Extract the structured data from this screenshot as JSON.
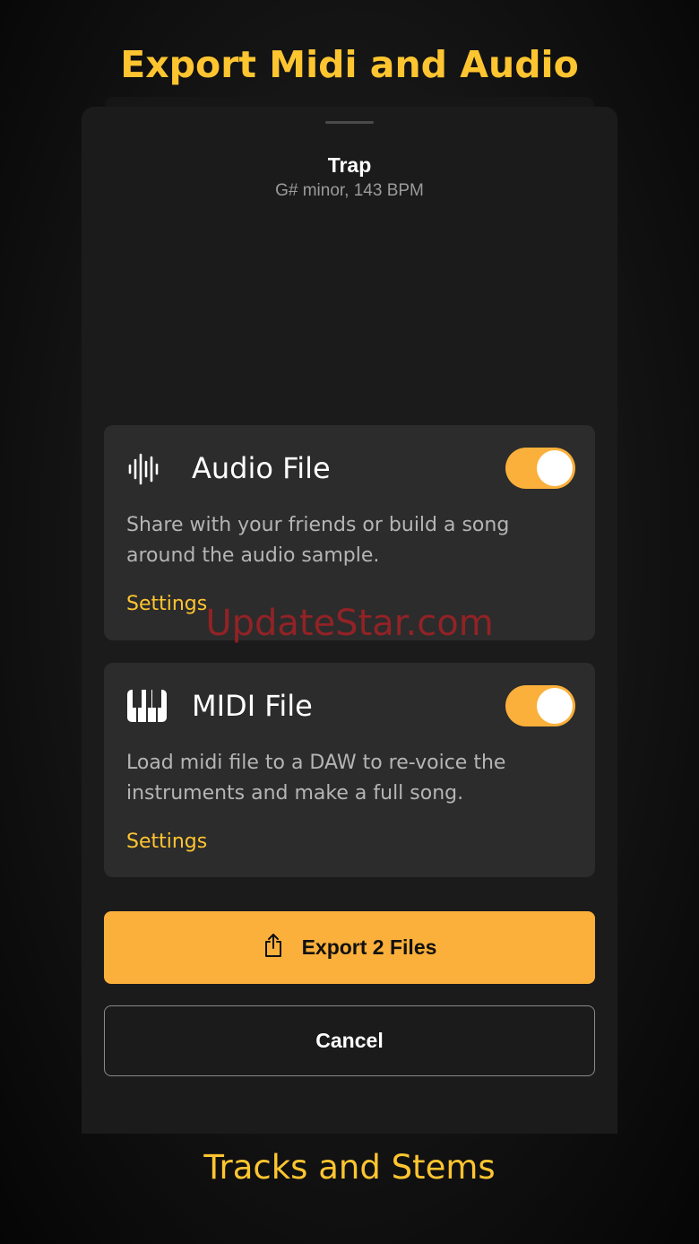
{
  "headline": "Export Midi and Audio",
  "sheet": {
    "title": "Trap",
    "subtitle": "G# minor, 143 BPM"
  },
  "audio_card": {
    "icon": "waveform-icon",
    "label": "Audio File",
    "description": "Share with your friends or build a song around the audio sample.",
    "settings_label": "Settings",
    "enabled": true
  },
  "midi_card": {
    "icon": "piano-keys-icon",
    "label": "MIDI File",
    "description": "Load midi file to a DAW to re-voice the instruments and make a full song.",
    "settings_label": "Settings",
    "enabled": true
  },
  "actions": {
    "export_icon": "share-icon",
    "export_label": "Export 2 Files",
    "cancel_label": "Cancel"
  },
  "watermark": "UpdateStar.com",
  "footer": "Tracks and Stems",
  "colors": {
    "accent": "#ffc530",
    "button": "#fbb03b",
    "card": "#2c2c2c",
    "sheet": "#1b1b1b"
  }
}
